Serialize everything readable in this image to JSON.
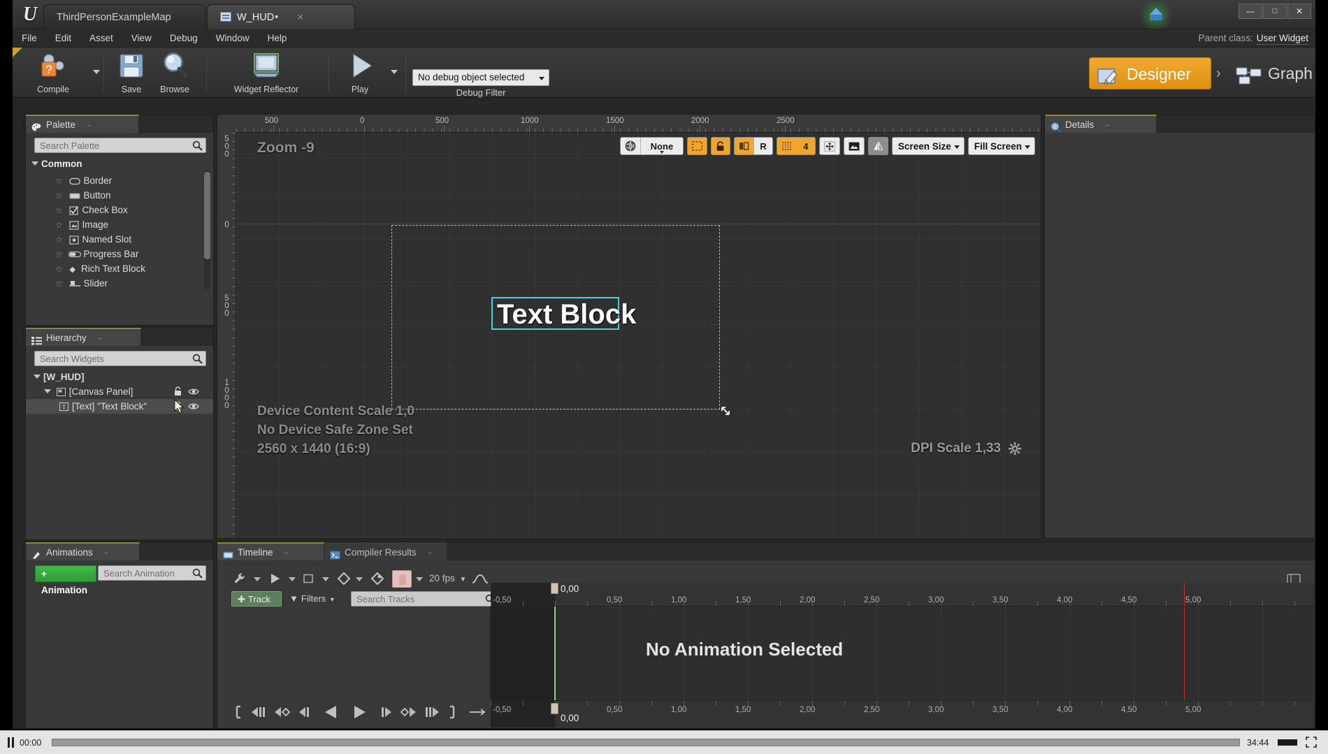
{
  "window": {
    "tabs": [
      {
        "label": "ThirdPersonExampleMap",
        "active": false,
        "dirty": "",
        "icon": "map-tab-icon"
      },
      {
        "label": "W_HUD",
        "active": true,
        "dirty": "•",
        "icon": "widget-tab-icon"
      }
    ],
    "controls": {
      "minimize": "—",
      "maximize": "❐",
      "close": "✕"
    },
    "level_badge_icon": "blueprint-cube-icon"
  },
  "menubar": {
    "items": [
      "File",
      "Edit",
      "Asset",
      "View",
      "Debug",
      "Window",
      "Help"
    ],
    "parent_class_label": "Parent class:",
    "parent_class_value": "User Widget"
  },
  "toolbar": {
    "compile": "Compile",
    "save": "Save",
    "browse": "Browse",
    "widget_reflector": "Widget Reflector",
    "play": "Play",
    "debug_object": "No debug object selected",
    "debug_filter_label": "Debug Filter"
  },
  "modes": {
    "designer": "Designer",
    "graph": "Graph",
    "separator": "›"
  },
  "palette": {
    "tab_label": "Palette",
    "tab_icon": "palette-icon",
    "search_placeholder": "Search Palette",
    "category": "Common",
    "items": [
      {
        "label": "Border",
        "icon": "border-widget-icon"
      },
      {
        "label": "Button",
        "icon": "button-widget-icon"
      },
      {
        "label": "Check Box",
        "icon": "checkbox-widget-icon"
      },
      {
        "label": "Image",
        "icon": "image-widget-icon"
      },
      {
        "label": "Named Slot",
        "icon": "named-slot-widget-icon"
      },
      {
        "label": "Progress Bar",
        "icon": "progress-bar-widget-icon"
      },
      {
        "label": "Rich Text Block",
        "icon": "rich-text-widget-icon"
      },
      {
        "label": "Slider",
        "icon": "slider-widget-icon"
      }
    ]
  },
  "hierarchy": {
    "tab_label": "Hierarchy",
    "tab_icon": "hierarchy-icon",
    "search_placeholder": "Search Widgets",
    "rows": [
      {
        "label": "[W_HUD]",
        "depth": 0,
        "selected": false,
        "icon": "",
        "lock": false,
        "eye": false
      },
      {
        "label": "[Canvas Panel]",
        "depth": 1,
        "selected": false,
        "icon": "canvas-panel-icon",
        "lock": true,
        "eye": true
      },
      {
        "label": "[Text] \"Text Block\"",
        "depth": 2,
        "selected": true,
        "icon": "text-widget-icon",
        "lock": true,
        "eye": true
      }
    ]
  },
  "details": {
    "tab_label": "Details",
    "tab_icon": "details-info-icon"
  },
  "viewport": {
    "zoom_label": "Zoom -9",
    "device_content_scale": "Device Content Scale 1,0",
    "safe_zone": "No Device Safe Zone Set",
    "resolution": "2560 x 1440 (16:9)",
    "dpi_scale": "DPI Scale 1,33",
    "dpi_gear_icon": "gear-icon",
    "selected_widget_text": "Text Block",
    "ruler_h_labels": [
      "500",
      "0",
      "500",
      "1000",
      "1500",
      "2000",
      "2500"
    ],
    "ruler_v_labels": [
      "500",
      "0",
      "500",
      "1000"
    ],
    "toolbar": {
      "globe_icon": "world-globe-icon",
      "none_label": "None",
      "dashed_box_icon": "outline-toggle-icon",
      "lock_icon": "lock-icon",
      "localization_icon": "localization-preview-icon",
      "r_label": "R",
      "grid_icon": "grid-snap-icon",
      "grid_size": "4",
      "resize_icon": "size-to-content-icon",
      "image_icon": "thumbnail-icon",
      "mirror_icon": "flip-rtl-icon",
      "screen_size": "Screen Size",
      "fill_screen": "Fill Screen"
    }
  },
  "animations": {
    "tab_label": "Animations",
    "tab_icon": "animations-icon",
    "add_button": "+ Animation",
    "search_placeholder": "Search Animation"
  },
  "timeline": {
    "tabs": [
      {
        "label": "Timeline",
        "icon": "timeline-icon",
        "active": true
      },
      {
        "label": "Compiler Results",
        "icon": "compiler-results-icon",
        "active": false
      }
    ],
    "fps": "20 fps",
    "track_button": "Track",
    "filters_button": "Filters",
    "search_placeholder": "Search Tracks",
    "current_time": "0,00",
    "playhead_time": "0,00",
    "no_animation": "No Animation Selected",
    "ruler_labels": [
      "-0,50",
      "0,50",
      "1,00",
      "1,50",
      "2,00",
      "2,50",
      "3,00",
      "3,50",
      "4,00",
      "4,50",
      "5,00"
    ],
    "ruler_values": [
      -0.5,
      0.5,
      1.0,
      1.5,
      2.0,
      2.5,
      3.0,
      3.5,
      4.0,
      4.5,
      5.0
    ],
    "transport_icons": [
      "jump-to-start",
      "step-back-frames",
      "prev-key",
      "step-back",
      "play-reverse",
      "play-forward",
      "step-forward",
      "next-key",
      "step-forward-frames",
      "jump-to-end",
      "loop-mode"
    ]
  },
  "player": {
    "pause_icon": "pause-icon",
    "elapsed": "00:00",
    "total": "34:44",
    "volume_icon": "volume-icon",
    "fullscreen_icon": "fullscreen-icon",
    "progress_percent": 0
  },
  "colors": {
    "accent_orange": "#f0a62a",
    "panel_bg": "#383838",
    "viewport_bg": "#303030",
    "selection_cyan": "#3fd3e0",
    "green_add": "#3fbb46",
    "tab_highlight": "#8a8a3c"
  }
}
